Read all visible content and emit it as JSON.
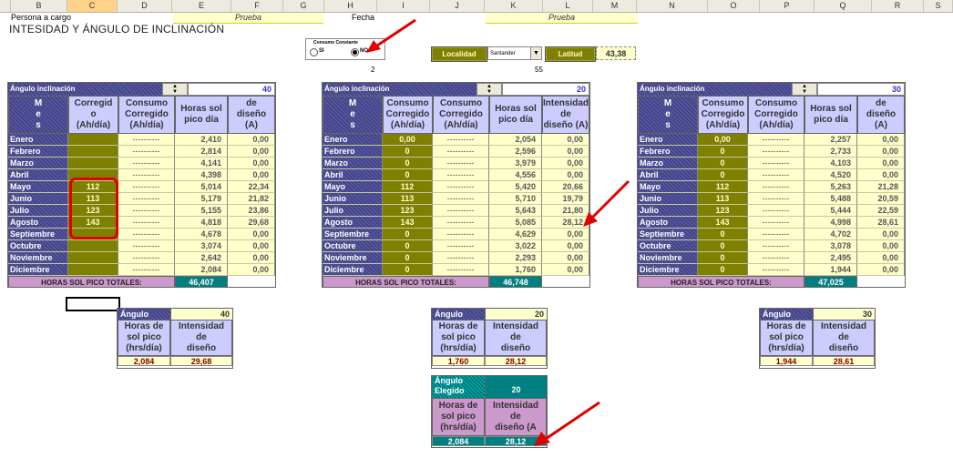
{
  "column_headers": [
    "B",
    "C",
    "D",
    "E",
    "F",
    "G",
    "H",
    "I",
    "J",
    "K",
    "L",
    "M",
    "N",
    "O",
    "P",
    "Q",
    "R",
    "S"
  ],
  "top": {
    "persona_label": "Persona a cargo",
    "persona_value": "Prueba",
    "fecha_label": "Fecha",
    "fecha_value": "Prueba",
    "title": "INTESIDAD Y ÁNGULO DE INCLINACIÓN",
    "radio_group_title": "Consumo Constante",
    "radio_si": "SI",
    "radio_no": "NO",
    "radio_selected": "NO",
    "below_radio_value": "2",
    "below_dropdown_value": "55",
    "localidad_label": "Localidad",
    "localidad_value": "Santander",
    "latitud_label": "Latitud",
    "latitud_value": "43,38"
  },
  "months": [
    "Enero",
    "Febrero",
    "Marzo",
    "Abril",
    "Mayo",
    "Junio",
    "Julio",
    "Agosto",
    "Septiembre",
    "Octubre",
    "Noviembre",
    "Diciembre"
  ],
  "dashes": "----------",
  "tables": [
    {
      "header_label": "Ángulo inclinación",
      "angle": "40",
      "col_mes": "M\ne\ns",
      "col_a": "Corregid\no\n(Ah/día)",
      "col_b": "Consumo\nCorregido\n(Ah/día)",
      "col_c": "Horas sol\npico día",
      "col_d": "de\ndiseño\n(A)",
      "consumo": [
        "",
        "",
        "",
        "",
        "112",
        "113",
        "123",
        "143",
        "",
        "",
        "",
        ""
      ],
      "horas": [
        "2,410",
        "2,814",
        "4,141",
        "4,398",
        "5,014",
        "5,179",
        "5,155",
        "4,818",
        "4,678",
        "3,074",
        "2,642",
        "2,084"
      ],
      "intensidad": [
        "0,00",
        "0,00",
        "0,00",
        "0,00",
        "22,34",
        "21,82",
        "23,86",
        "29,68",
        "0,00",
        "0,00",
        "0,00",
        "0,00"
      ],
      "total_label": "HORAS SOL PICO TOTALES:",
      "total_value": "46,407"
    },
    {
      "header_label": "Ángulo inclinación",
      "angle": "20",
      "col_mes": "M\ne\ns",
      "col_a": "Consumo\nCorregido\n(Ah/día)",
      "col_b": "Consumo\nCorregido\n(Ah/día)",
      "col_c": "Horas sol\npico día",
      "col_d": "Intensidad\nde\ndiseño (A)",
      "consumo": [
        "0,00",
        "0",
        "0",
        "0",
        "112",
        "113",
        "123",
        "143",
        "0",
        "0",
        "0",
        "0"
      ],
      "horas": [
        "2,054",
        "2,596",
        "3,979",
        "4,556",
        "5,420",
        "5,710",
        "5,643",
        "5,085",
        "4,629",
        "3,022",
        "2,293",
        "1,760"
      ],
      "intensidad": [
        "0,00",
        "0,00",
        "0,00",
        "0,00",
        "20,66",
        "19,79",
        "21,80",
        "28,12",
        "0,00",
        "0,00",
        "0,00",
        "0,00"
      ],
      "total_label": "HORAS SOL PICO TOTALES:",
      "total_value": "46,748"
    },
    {
      "header_label": "Ángulo inclinación",
      "angle": "30",
      "col_mes": "M\ne\ns",
      "col_a": "Consumo\nCorregido\n(Ah/día)",
      "col_b": "Consumo\nCorregido\n(Ah/día)",
      "col_c": "Horas sol\npico día",
      "col_d": "de\ndiseño\n(A)",
      "consumo": [
        "0,00",
        "0",
        "0",
        "0",
        "112",
        "113",
        "123",
        "143",
        "0",
        "0",
        "0",
        "0"
      ],
      "horas": [
        "2,257",
        "2,733",
        "4,103",
        "4,520",
        "5,263",
        "5,488",
        "5,444",
        "4,998",
        "4,702",
        "3,078",
        "2,495",
        "1,944"
      ],
      "intensidad": [
        "0,00",
        "0,00",
        "0,00",
        "0,00",
        "21,28",
        "20,59",
        "22,59",
        "28,61",
        "0,00",
        "0,00",
        "0,00",
        "0,00"
      ],
      "total_label": "HORAS SOL PICO TOTALES:",
      "total_value": "47,025"
    }
  ],
  "summaries": [
    {
      "label": "Ángulo",
      "angle": "40",
      "col1": "Horas de\nsol pico\n(hrs/día)",
      "col2": "Intensidad\nde\ndiseño",
      "v1": "2,084",
      "v2": "29,68"
    },
    {
      "label": "Ángulo",
      "angle": "20",
      "col1": "Horas de\nsol pico\n(hrs/día)",
      "col2": "Intensidad\nde\ndiseño",
      "v1": "1,760",
      "v2": "28,12"
    },
    {
      "label": "Ángulo",
      "angle": "30",
      "col1": "Horas de\nsol pico\n(hrs/día)",
      "col2": "Intensidad\nde\ndiseño",
      "v1": "1,944",
      "v2": "28,61"
    }
  ],
  "chosen": {
    "label": "Ángulo\nElegido",
    "angle": "20",
    "col1": "Horas de\nsol pico\n(hrs/día)",
    "col2": "Intensidad\nde\ndiseño (A",
    "v1": "2,084",
    "v2": "28,12"
  },
  "colors": {
    "navy_pattern": "#4b4b8a",
    "lavender": "#ccccff",
    "olive": "#808000",
    "cream": "#ffffcc",
    "teal": "#008080",
    "pink": "#cc99cc",
    "red_annotation": "#e00000"
  }
}
